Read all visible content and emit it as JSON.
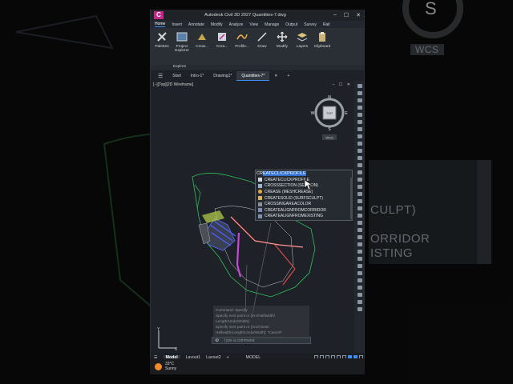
{
  "app": {
    "title": "Autodesk Civil 3D 2027    Quantities-7.dwg",
    "logo": "C",
    "window_controls": [
      "–",
      "☐",
      "✕"
    ]
  },
  "menu": [
    "Home",
    "Insert",
    "Annotate",
    "Modify",
    "Analyze",
    "View",
    "Manage",
    "Output",
    "Survey",
    "Rail"
  ],
  "ribbon": {
    "buttons": [
      {
        "label": "Palettes",
        "icon": "palettes-icon"
      },
      {
        "label": "Project Explorer",
        "icon": "project-explorer-icon"
      },
      {
        "label": "Creat...",
        "icon": "create-ground-data-icon"
      },
      {
        "label": "Crea...",
        "icon": "create-design-icon"
      },
      {
        "label": "Profile...",
        "icon": "profile-view-icon"
      },
      {
        "label": "Draw",
        "icon": "draw-icon"
      },
      {
        "label": "Modify",
        "icon": "modify-icon"
      },
      {
        "label": "Layers",
        "icon": "layers-icon"
      },
      {
        "label": "Clipboard",
        "icon": "clipboard-icon"
      }
    ],
    "panel_label": "Explore"
  },
  "tabs": [
    "Start",
    "Intro-1*",
    "Drawing1*",
    "Quantities-7*"
  ],
  "viewport": {
    "label": "[−][Top][2D Wireframe]",
    "controls": "– ☐ ✕",
    "wcs": "WCS",
    "compass": {
      "n": "N",
      "s": "S",
      "e": "E",
      "w": "W",
      "center": "TOP"
    }
  },
  "autocomplete": {
    "typed": "CR",
    "selection": "EATECLICKPROFILE",
    "items": [
      {
        "label": "CREATECLICKPROFILE",
        "icon": "profile-icon"
      },
      {
        "label": "CROSSSECTION (SECTION)",
        "icon": "section-icon"
      },
      {
        "label": "CREASE (MESHCREASE)",
        "icon": "crease-icon"
      },
      {
        "label": "CREATESOLID (SURFSCULPT)",
        "icon": "solid-icon"
      },
      {
        "label": "CROSSINGAREACOLOR",
        "icon": "command-icon"
      },
      {
        "label": "CREATEALIGNFROMCORRIDOR",
        "icon": "alignment-icon"
      },
      {
        "label": "CREATEALIGNFROMEXISTING",
        "icon": "alignment-icon"
      }
    ]
  },
  "command_history": [
    "Command: Specify",
    "Specify next point or [Arc/Halfwidth/",
    "Length/Undo/Width]:",
    "Specify next point or [Arc/Close/",
    "Halfwidth/Length/Undo/Width]: *Cancel*"
  ],
  "command_line": {
    "placeholder": "Type a command"
  },
  "statusbar": {
    "layout_tabs": [
      "Model",
      "Layout1",
      "Layout2"
    ],
    "mode": "MODEL",
    "add": "+"
  },
  "taskbar": {
    "temperature": "33°C",
    "condition": "Sunny"
  },
  "background_text": [
    "S",
    "WCS",
    "CULPT)",
    "ORRIDOR",
    "ISTING"
  ],
  "colors": {
    "accent": "#3c8ef0",
    "logo": "#c1288a",
    "sun": "#f28c28"
  }
}
